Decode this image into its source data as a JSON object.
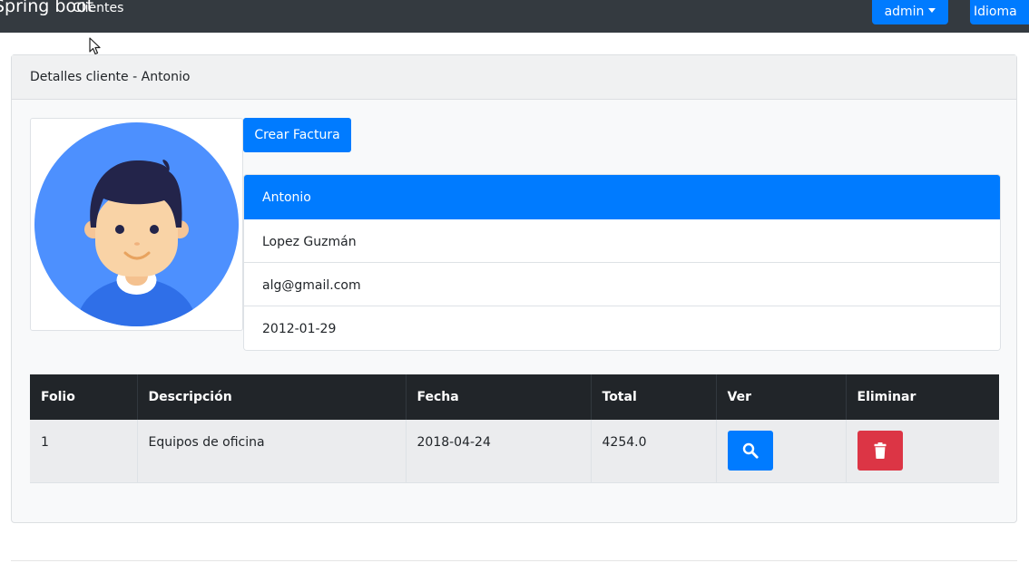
{
  "navbar": {
    "brand": "Spring boot",
    "clientes_link": "Clientes",
    "user_button": "admin",
    "language_button": "Idioma"
  },
  "card": {
    "header": "Detalles cliente - Antonio",
    "create_invoice_button": "Crear Factura"
  },
  "client": {
    "nombre": "Antonio",
    "apellido": "Lopez Guzmán",
    "email": "alg@gmail.com",
    "fecha": "2012-01-29"
  },
  "facturas_table": {
    "headers": [
      "Folio",
      "Descripción",
      "Fecha",
      "Total",
      "Ver",
      "Eliminar"
    ],
    "rows": [
      {
        "folio": "1",
        "descripcion": "Equipos de oficina",
        "fecha": "2018-04-24",
        "total": "4254.0"
      }
    ]
  },
  "icons": {
    "view": "search-icon",
    "delete": "trash-icon",
    "avatar": "user-avatar"
  },
  "colors": {
    "primary": "#007bff",
    "danger": "#dc3545",
    "dark": "#343a40",
    "table_header": "#212529"
  }
}
